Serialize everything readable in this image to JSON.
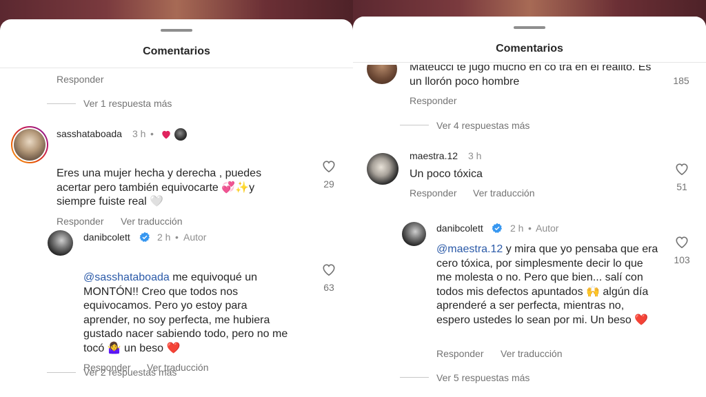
{
  "colors": {
    "mention": "#2b5aa8",
    "muted_text": "#737373",
    "red_heart": "#e0245e",
    "verified_blue": "#3797f0",
    "story_ring_start": "#f9a825",
    "story_ring_end": "#c2185b"
  },
  "left": {
    "title": "Comentarios",
    "top_reply_label": "Responder",
    "top_more_replies": "Ver 1 respuesta más",
    "comment1": {
      "username": "sasshataboada",
      "time": "3 h",
      "dot": "•",
      "text": "Eres una mujer hecha y derecha , puedes acertar pero también equivocarte 💞✨y siempre fuiste real 🤍",
      "likes": "29",
      "reply_label": "Responder",
      "translate_label": "Ver traducción"
    },
    "reply1": {
      "username": "danibcolett",
      "time": "2 h",
      "dot": "•",
      "author_badge": "Autor",
      "mention": "@sasshataboada",
      "text": " me equivoqué un MONTÓN!! Creo que todos nos equivocamos. Pero yo estoy para aprender, no soy perfecta, me hubiera gustado nacer sabiendo todo, pero no me tocó 🤷‍♀️ un beso ❤️",
      "likes": "63",
      "reply_label": "Responder",
      "translate_label": "Ver traducción"
    },
    "bottom_more_replies": "Ver 2 respuestas más"
  },
  "right": {
    "title": "Comentarios",
    "cut_comment": {
      "text": "Mateucci te jugo mucho en co tra en el realito. Es un llorón poco hombre",
      "likes": "185",
      "reply_label": "Responder"
    },
    "more_replies_1": "Ver 4 respuestas más",
    "comment2": {
      "username": "maestra.12",
      "time": "3 h",
      "text": "Un poco tóxica",
      "likes": "51",
      "reply_label": "Responder",
      "translate_label": "Ver traducción"
    },
    "reply2": {
      "username": "danibcolett",
      "time": "2 h",
      "dot": "•",
      "author_badge": "Autor",
      "mention": "@maestra.12",
      "text": " y mira que yo pensaba que era cero tóxica, por simplesmente decir lo que me molesta o no. Pero que bien... salí con todos mis defectos apuntados 🙌 algún día aprenderé a ser perfecta, mientras no, espero ustedes lo sean por mi. Un beso ❤️",
      "likes": "103",
      "reply_label": "Responder",
      "translate_label": "Ver traducción"
    },
    "more_replies_2": "Ver 5 respuestas más"
  }
}
